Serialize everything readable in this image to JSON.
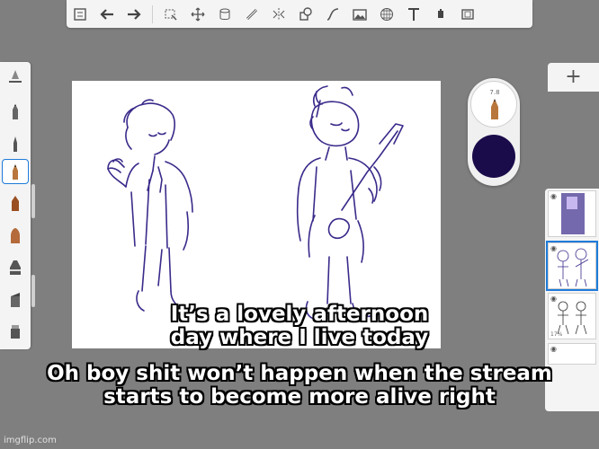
{
  "toolbar": {
    "tools": [
      "menu-icon",
      "undo-icon",
      "redo-icon",
      "select-icon",
      "transform-icon",
      "fill-icon",
      "ruler-icon",
      "symmetry-icon",
      "shapes-icon",
      "curve-icon",
      "image-icon",
      "perspective-icon",
      "text-icon",
      "layer-icon",
      "fullscreen-icon"
    ]
  },
  "brushes": [
    "eraser-icon",
    "pencil-icon",
    "pen-icon",
    "fineliner-icon",
    "marker-icon",
    "brush-icon",
    "airbrush-icon",
    "chisel-icon",
    "smudge-icon",
    "blender-icon"
  ],
  "puck": {
    "size_label": "7.8",
    "color": "#1a0b4a"
  },
  "layers": {
    "add_label": "+",
    "numbers": [
      "",
      "",
      "",
      "17%"
    ]
  },
  "captions": {
    "line1": "It’s a lovely afternoon",
    "line2": "day where I live today",
    "line3": "Oh boy shit won’t happen when the stream",
    "line4": "starts to become more alive right"
  },
  "watermark": "imgflip.com",
  "colors": {
    "line_art": "#3a2a8a",
    "accent": "#1e7bd9"
  }
}
